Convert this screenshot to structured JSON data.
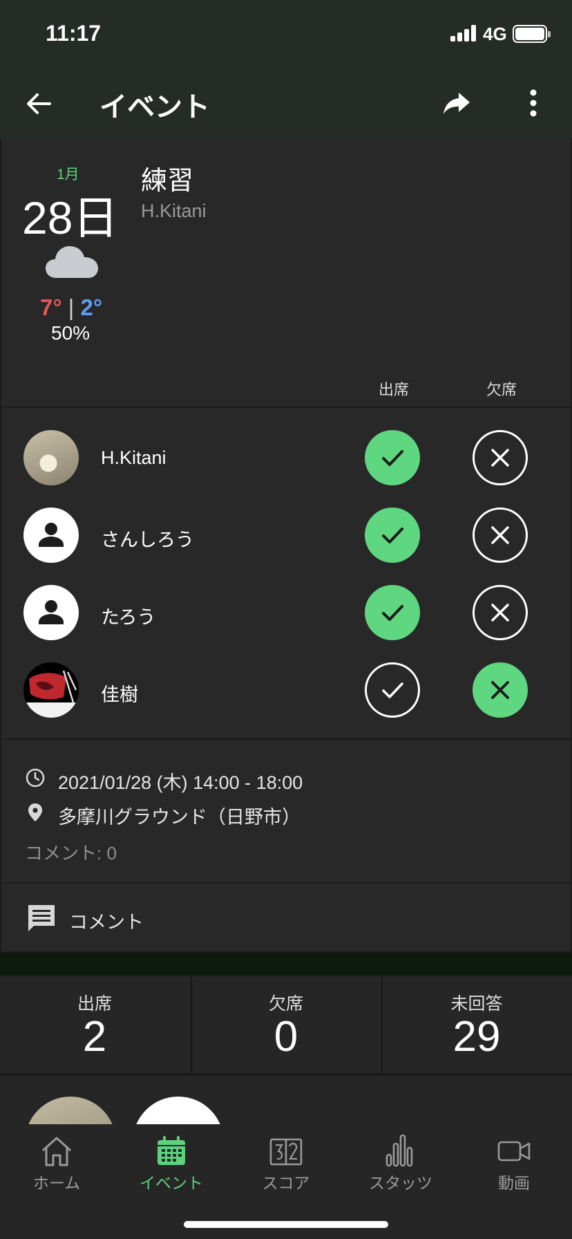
{
  "status_bar": {
    "time": "11:17",
    "network": "4G"
  },
  "app_bar": {
    "title": "イベント"
  },
  "event": {
    "month": "1月",
    "day": "28日",
    "weather_icon": "cloud-icon",
    "temp_high": "7°",
    "temp_separator": "|",
    "temp_low": "2°",
    "rain_chance": "50%",
    "name": "練習",
    "owner": "H.Kitani",
    "col_attend": "出席",
    "col_absent": "欠席"
  },
  "members": [
    {
      "name": "H.Kitani",
      "avatar": "photo",
      "status": "attend"
    },
    {
      "name": "さんしろう",
      "avatar": "default-person",
      "status": "attend"
    },
    {
      "name": "たろう",
      "avatar": "default-person",
      "status": "attend"
    },
    {
      "name": "佳樹",
      "avatar": "photo",
      "status": "absent"
    }
  ],
  "info": {
    "datetime": "2021/01/28 (木) 14:00 - 18:00",
    "location": "多摩川グラウンド（日野市）",
    "comment_count": "コメント: 0"
  },
  "comment": {
    "label": "コメント"
  },
  "summary": [
    {
      "label": "出席",
      "value": "2"
    },
    {
      "label": "欠席",
      "value": "0"
    },
    {
      "label": "未回答",
      "value": "29"
    }
  ],
  "tabs": [
    {
      "label": "ホーム",
      "icon": "home-icon",
      "active": false
    },
    {
      "label": "イベント",
      "icon": "calendar-icon",
      "active": true
    },
    {
      "label": "スコア",
      "icon": "scoreboard-icon",
      "active": false
    },
    {
      "label": "スタッツ",
      "icon": "bar-chart-icon",
      "active": false
    },
    {
      "label": "動画",
      "icon": "video-icon",
      "active": false
    }
  ],
  "colors": {
    "accent_green": "#5dd27c",
    "temp_high": "#e0585e",
    "temp_low": "#5b9ef2",
    "app_bar_bg": "#252b27",
    "card_bg": "#282828"
  }
}
